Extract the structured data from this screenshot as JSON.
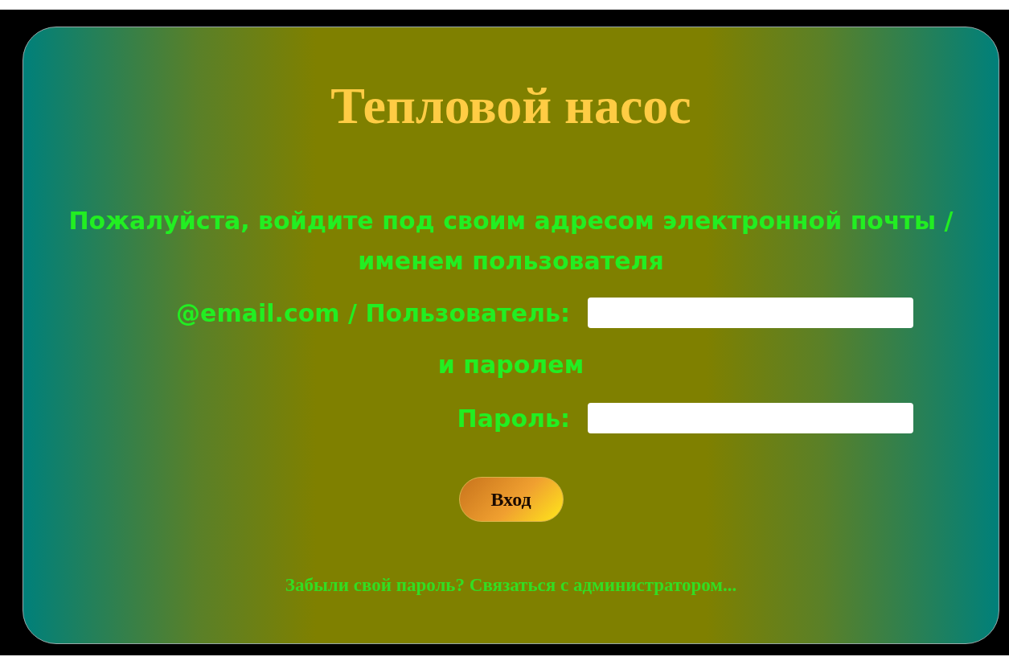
{
  "title": "Тепловой насос",
  "prompt": "Пожалуйста, войдите под своим адресом электронной почты / именем пользователя",
  "fields": [
    {
      "label": "@email.com / Пользователь:",
      "kind": "text"
    },
    {
      "kind": "separator",
      "label": "и паролем"
    },
    {
      "label": "Пароль:",
      "kind": "password"
    }
  ],
  "button": "Вход",
  "link": "Забыли свой пароль? Связаться с администратором..."
}
